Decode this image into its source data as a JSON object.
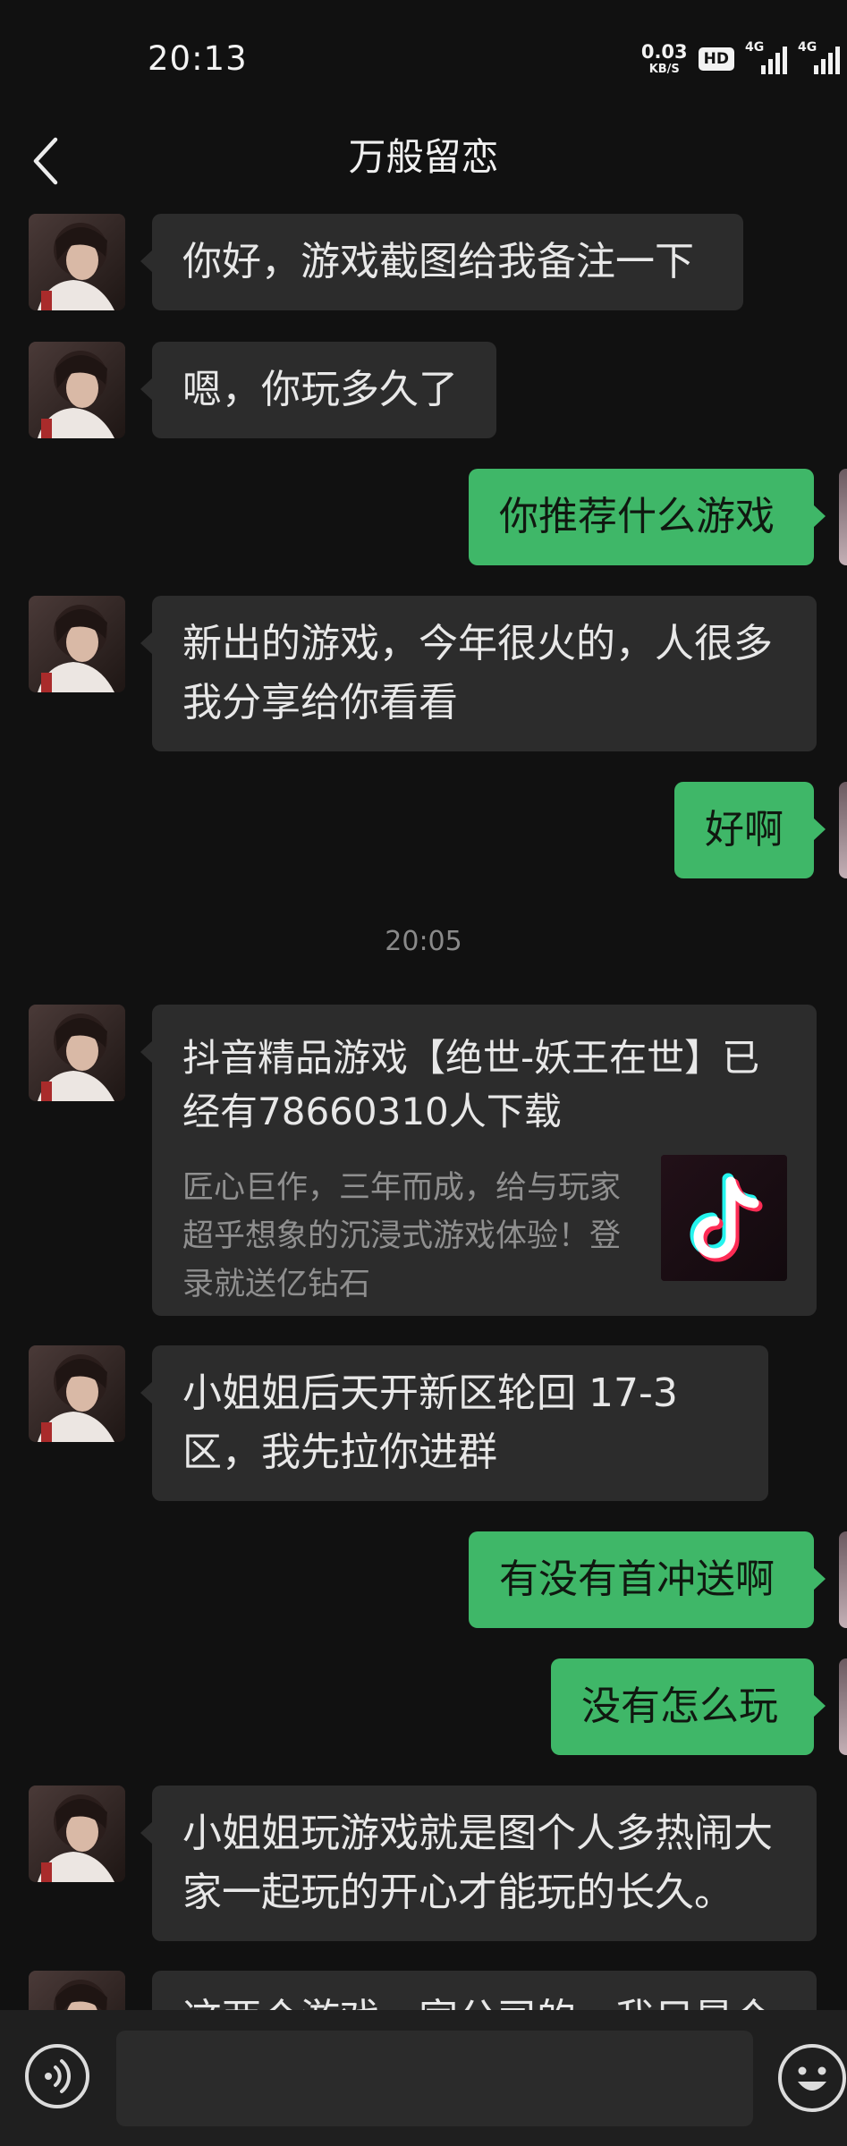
{
  "status_bar": {
    "time": "20:13",
    "net_speed_value": "0.03",
    "net_speed_unit": "KB/S",
    "hd_badge": "HD",
    "signal1_label": "4G",
    "signal2_label": "4G"
  },
  "header": {
    "title": "万般留恋"
  },
  "messages": [
    {
      "from": "them",
      "text": "你好，游戏截图给我备注一下"
    },
    {
      "from": "them",
      "text": "嗯，你玩多久了"
    },
    {
      "from": "me",
      "text": "你推荐什么游戏"
    },
    {
      "from": "them",
      "text": "新出的游戏，今年很火的，人很多我分享给你看看"
    },
    {
      "from": "me",
      "text": "好啊"
    },
    {
      "from": "them",
      "text": "小姐姐后天开新区轮回 17-3 区，我先拉你进群"
    },
    {
      "from": "me",
      "text": "有没有首冲送啊"
    },
    {
      "from": "me",
      "text": "没有怎么玩"
    },
    {
      "from": "them",
      "text": "小姐姐玩游戏就是图个人多热闹大家一起玩的开心才能玩的长久。"
    },
    {
      "from": "them",
      "text": "这两个游戏一家公司的，我只是个"
    }
  ],
  "timestamp": "20:05",
  "share_card": {
    "title": "抖音精品游戏【绝世-妖王在世】已经有78660310人下载",
    "description": "匠心巨作，三年而成，给与玩家超乎想象的沉浸式游戏体验！登录就送亿钻石",
    "thumbnail_icon": "tiktok-logo",
    "brand_colors": [
      "#25F4EE",
      "#FE2C55",
      "#FFFFFF"
    ]
  },
  "input": {
    "value": "",
    "placeholder": ""
  },
  "colors": {
    "background": "#111111",
    "incoming_bubble": "#2c2c2c",
    "outgoing_bubble": "#3fb768",
    "timestamp_text": "#8a8a8a"
  },
  "icons": {
    "back": "chevron-left-icon",
    "voice": "voice-icon",
    "emoji": "emoji-icon"
  }
}
